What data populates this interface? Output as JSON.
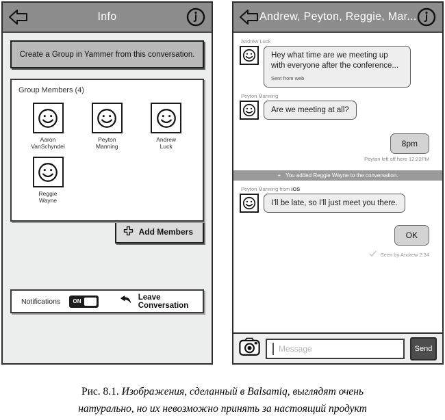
{
  "left_panel": {
    "titlebar": {
      "back_icon": "back-arrow-icon",
      "title": "Info",
      "info_icon": "info-circle-icon"
    },
    "yammer_button": "Create a Group in Yammer from this conversation.",
    "members_card": {
      "heading": "Group Members  (4)",
      "members": [
        {
          "first": "Aaron",
          "last": "VanSchyndel",
          "avatar": "smiley-avatar-icon"
        },
        {
          "first": "Peyton",
          "last": "Manning",
          "avatar": "smiley-avatar-icon"
        },
        {
          "first": "Andrew",
          "last": "Luck",
          "avatar": "smiley-avatar-icon"
        },
        {
          "first": "Reggie",
          "last": "Wayne",
          "avatar": "smiley-avatar-icon"
        }
      ]
    },
    "add_members_button": {
      "label": "Add Members",
      "icon": "plus-icon"
    },
    "settings": {
      "notifications_label": "Notifications",
      "toggle_value": "ON",
      "leave_label": "Leave Conversation",
      "leave_icon": "back-arrow-icon"
    }
  },
  "right_panel": {
    "titlebar": {
      "back_icon": "back-arrow-icon",
      "title": "Andrew, Peyton, Reggie, Mar...",
      "info_icon": "info-circle-icon"
    },
    "messages": [
      {
        "kind": "incoming",
        "sender": "Andrew Luck",
        "sender_suffix": "",
        "text": "Hey what time are we meeting up with everyone after the conference...",
        "meta": "Sent from web",
        "avatar": "smiley-avatar-icon"
      },
      {
        "kind": "incoming",
        "sender": "Peyton Manning",
        "sender_suffix": "",
        "text": "Are we meeting at all?",
        "meta": "",
        "avatar": "smiley-avatar-icon"
      },
      {
        "kind": "outgoing",
        "text": "8pm",
        "meta": "Peyton left off here 12:22PM"
      },
      {
        "kind": "system",
        "icon": "plus-icon",
        "text": "You added Reggie Wayne to the conversation."
      },
      {
        "kind": "incoming",
        "sender": "Peyton Manning from ",
        "sender_suffix": "iOS",
        "text": "I'll be late, so I'll just meet you there.",
        "meta": "",
        "avatar": "smiley-avatar-icon"
      },
      {
        "kind": "outgoing",
        "text": "OK",
        "meta": "",
        "seen_icon": "check-icon",
        "seen_text": "Seen by Andrew 2:34"
      }
    ],
    "composer": {
      "camera_icon": "camera-icon",
      "input_value": "",
      "input_placeholder": "Message",
      "send_label": "Send"
    }
  },
  "caption": {
    "figure_number": "Рис. 8.1.",
    "line1": " Изображения, сделанный в Balsamiq, выглядят очень",
    "line2": "натурально, но их невозможно принять за настоящий продукт"
  },
  "colors": {
    "titlebar": "#8d8d8d",
    "panel_bg": "#eceded",
    "chat_bg": "#ffffff",
    "bubble_in": "#eeeeee",
    "bubble_out": "#d3d3d3",
    "system_bar": "#9a9a9a",
    "send_button": "#4d4d4d",
    "toggle_on": "#1d1d1d"
  }
}
